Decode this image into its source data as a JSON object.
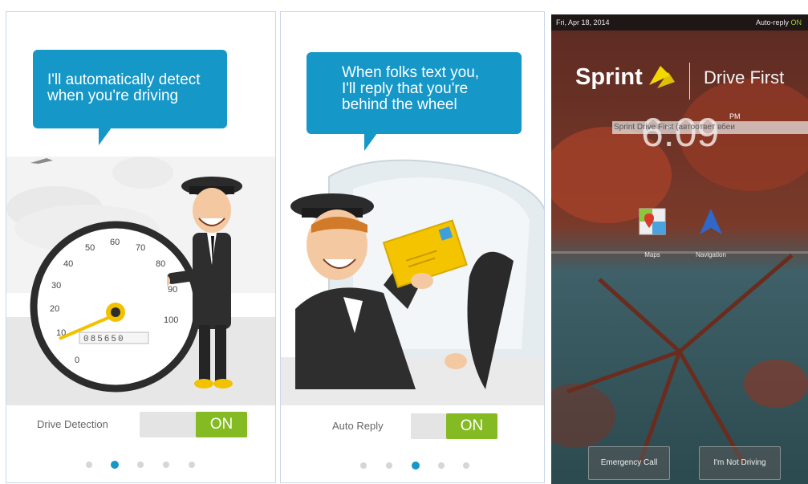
{
  "screens": [
    {
      "bubble_lines": [
        "I'll automatically detect",
        "when you're driving"
      ],
      "toggle_label": "Drive Detection",
      "toggle_state": "ON",
      "speedometer": {
        "labels": [
          "0",
          "10",
          "20",
          "30",
          "40",
          "50",
          "60",
          "70",
          "80",
          "90",
          "100"
        ],
        "odometer": "085650"
      },
      "page_dots": 5,
      "active_dot": 2
    },
    {
      "bubble_lines": [
        "When folks text you,",
        "I'll reply that you're",
        "behind the wheel"
      ],
      "toggle_label": "Auto Reply",
      "toggle_state": "ON",
      "page_dots": 5,
      "active_dot": 3
    }
  ],
  "lockscreen": {
    "status_date": "Fri, Apr 18, 2014",
    "status_autoreply": "Auto-reply",
    "status_autoreply_state": "ON",
    "brand": "Sprint",
    "product": "Drive First",
    "time": "6:09",
    "ampm": "PM",
    "notification": "Sprint Drive First  (автоответ вбеи",
    "apps": [
      {
        "label": "Maps",
        "icon": "maps-icon"
      },
      {
        "label": "Navigation",
        "icon": "navigation-icon"
      }
    ],
    "buttons": {
      "emergency": "Emergency Call",
      "not_driving": "I'm Not Driving"
    }
  },
  "colors": {
    "bubble": "#1597c8",
    "toggle_on": "#85bb22",
    "sprint_yellow": "#f5d800"
  }
}
